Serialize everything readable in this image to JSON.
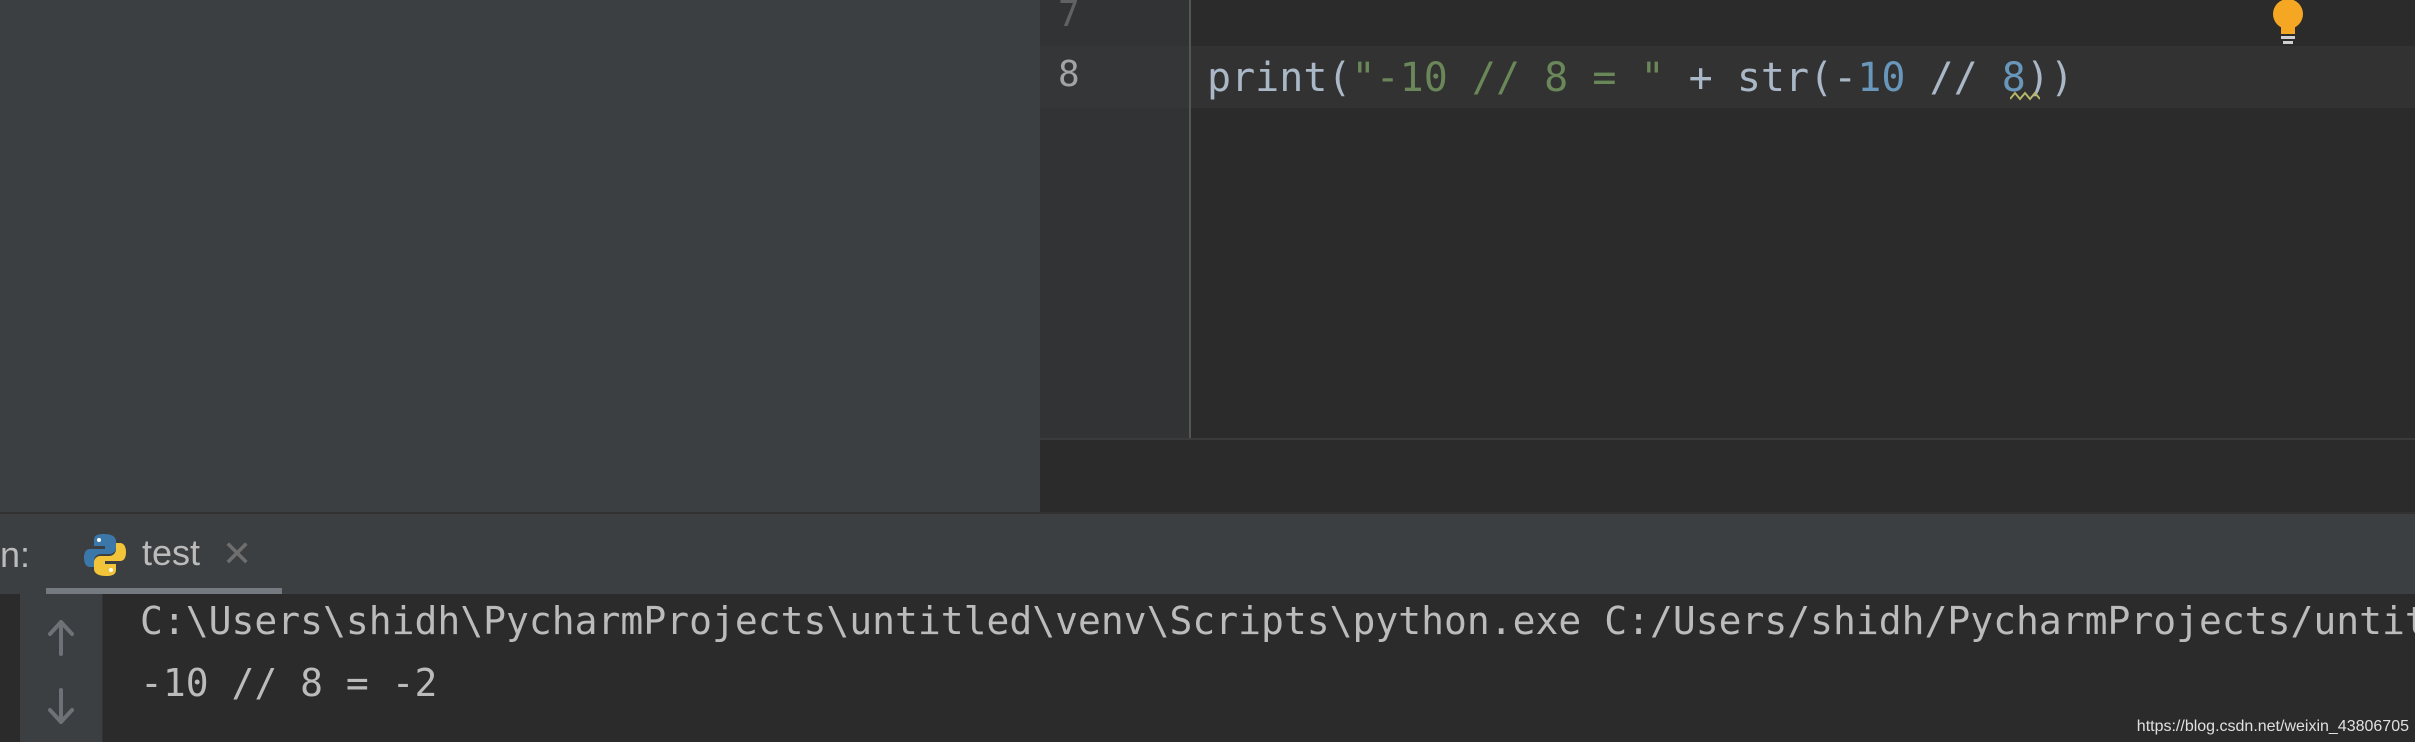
{
  "editor": {
    "line_numbers": [
      "7",
      "8"
    ],
    "code_tokens": [
      {
        "text": "print(",
        "cls": "tok-plain"
      },
      {
        "text": "\"-10 // 8 = \"",
        "cls": "tok-str"
      },
      {
        "text": " + str(-",
        "cls": "tok-plain"
      },
      {
        "text": "10",
        "cls": "tok-num"
      },
      {
        "text": " // ",
        "cls": "tok-plain"
      },
      {
        "text": "8",
        "cls": "tok-num"
      },
      {
        "text": "))",
        "cls": "tok-plain"
      }
    ]
  },
  "run": {
    "label": "n:",
    "tab_label": "test",
    "close_glyph": "✕",
    "console_lines": [
      "C:\\Users\\shidh\\PycharmProjects\\untitled\\venv\\Scripts\\python.exe C:/Users/shidh/PycharmProjects/untitled/test.py",
      "-10 // 8 = -2"
    ]
  },
  "watermark": "https://blog.csdn.net/weixin_43806705",
  "colors": {
    "string": "#6a8759",
    "number": "#6897bb",
    "plain": "#a9b7c6",
    "bulb": "#f5a623"
  },
  "icons": [
    "lightbulb-icon",
    "python-icon",
    "close-icon",
    "arrow-up-icon",
    "arrow-down-icon"
  ]
}
